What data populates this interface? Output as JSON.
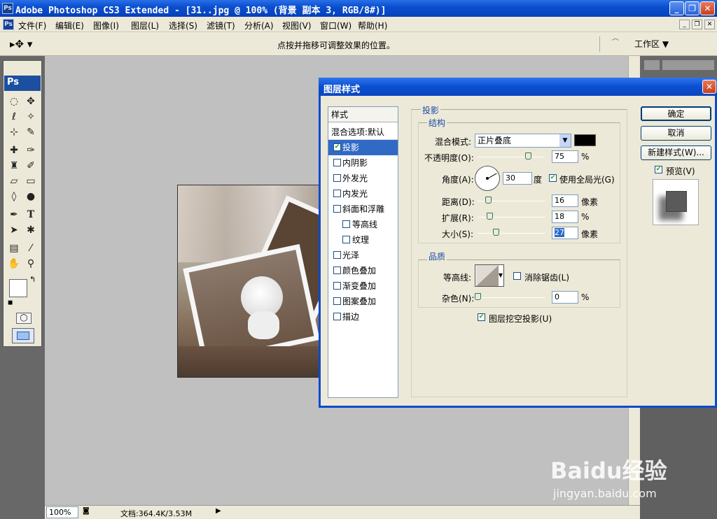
{
  "app": {
    "title": "Adobe Photoshop CS3 Extended - [31..jpg @ 100% (背景 副本 3, RGB/8#)]",
    "icon": "Ps"
  },
  "menubar": {
    "items": [
      "文件(F)",
      "编辑(E)",
      "图像(I)",
      "图层(L)",
      "选择(S)",
      "滤镜(T)",
      "分析(A)",
      "视图(V)",
      "窗口(W)",
      "帮助(H)"
    ]
  },
  "optionsbar": {
    "hint": "点按并拖移可调整效果的位置。",
    "workspace": "工作区 ▼"
  },
  "toolbox": {
    "logo": "Ps"
  },
  "statusbar": {
    "zoom": "100%",
    "doc": "文档:364.4K/3.53M"
  },
  "dialog": {
    "title": "图层样式",
    "styles_header": "样式",
    "blend_default": "混合选项:默认",
    "styles": [
      {
        "label": "投影",
        "checked": true,
        "selected": true,
        "indent": false
      },
      {
        "label": "内阴影",
        "checked": false,
        "indent": false
      },
      {
        "label": "外发光",
        "checked": false,
        "indent": false
      },
      {
        "label": "内发光",
        "checked": false,
        "indent": false
      },
      {
        "label": "斜面和浮雕",
        "checked": false,
        "indent": false
      },
      {
        "label": "等高线",
        "checked": false,
        "indent": true
      },
      {
        "label": "纹理",
        "checked": false,
        "indent": true
      },
      {
        "label": "光泽",
        "checked": false,
        "indent": false
      },
      {
        "label": "颜色叠加",
        "checked": false,
        "indent": false
      },
      {
        "label": "渐变叠加",
        "checked": false,
        "indent": false
      },
      {
        "label": "图案叠加",
        "checked": false,
        "indent": false
      },
      {
        "label": "描边",
        "checked": false,
        "indent": false
      }
    ],
    "section_title": "投影",
    "structure": {
      "title": "结构",
      "blend_mode_label": "混合模式:",
      "blend_mode_value": "正片叠底",
      "shadow_color": "#000000",
      "opacity_label": "不透明度(O):",
      "opacity_value": "75",
      "opacity_unit": "%",
      "opacity_level": 75,
      "angle_label": "角度(A):",
      "angle_value": "30",
      "angle_unit": "度",
      "global_light_label": "使用全局光(G)",
      "global_light_checked": true,
      "distance_label": "距离(D):",
      "distance_value": "16",
      "distance_unit": "像素",
      "distance_level": 16,
      "spread_label": "扩展(R):",
      "spread_value": "18",
      "spread_unit": "%",
      "spread_level": 18,
      "size_label": "大小(S):",
      "size_value": "27",
      "size_unit": "像素",
      "size_level": 27
    },
    "quality": {
      "title": "品质",
      "contour_label": "等高线:",
      "antialias_label": "消除锯齿(L)",
      "noise_label": "杂色(N):",
      "noise_value": "0",
      "noise_unit": "%",
      "noise_level": 0
    },
    "knockout_label": "图层挖空投影(U)",
    "knockout_checked": true,
    "buttons": {
      "ok": "确定",
      "cancel": "取消",
      "new_style": "新建样式(W)..."
    },
    "preview_label": "预览(V)",
    "preview_checked": true
  },
  "watermark": {
    "brand": "Baidu经验",
    "url": "jingyan.baidu.com"
  }
}
